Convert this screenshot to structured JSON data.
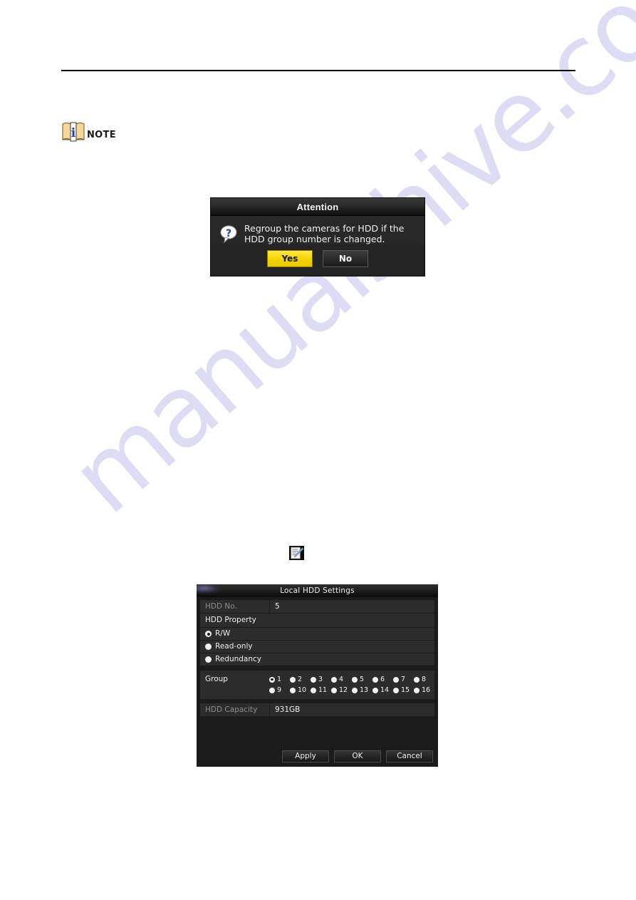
{
  "page": {
    "note_label": "NOTE",
    "note_icon": "note-book-icon",
    "edit_icon": "edit-pencil-icon",
    "watermark_text": "manualshive.com",
    "watermark_color": "#dcdcf5"
  },
  "attention_dialog": {
    "title": "Attention",
    "icon": "question-bubble-icon",
    "message": "Regroup the cameras for HDD if the\nHDD group number is changed.",
    "buttons": {
      "yes": "Yes",
      "no": "No"
    },
    "accent_color": "#f5d400"
  },
  "hdd_dialog": {
    "title": "Local HDD Settings",
    "hdd_no": {
      "label": "HDD No.",
      "value": "5"
    },
    "property_section": {
      "header": "HDD Property",
      "options": [
        {
          "label": "R/W",
          "selected": true
        },
        {
          "label": "Read-only",
          "selected": false
        },
        {
          "label": "Redundancy",
          "selected": false
        }
      ]
    },
    "group": {
      "label": "Group",
      "row1": [
        {
          "label": "1",
          "selected": true
        },
        {
          "label": "2",
          "selected": false
        },
        {
          "label": "3",
          "selected": false
        },
        {
          "label": "4",
          "selected": false
        },
        {
          "label": "5",
          "selected": false
        },
        {
          "label": "6",
          "selected": false
        },
        {
          "label": "7",
          "selected": false
        },
        {
          "label": "8",
          "selected": false
        }
      ],
      "row2": [
        {
          "label": "9",
          "selected": false
        },
        {
          "label": "10",
          "selected": false
        },
        {
          "label": "11",
          "selected": false
        },
        {
          "label": "12",
          "selected": false
        },
        {
          "label": "13",
          "selected": false
        },
        {
          "label": "14",
          "selected": false
        },
        {
          "label": "15",
          "selected": false
        },
        {
          "label": "16",
          "selected": false
        }
      ]
    },
    "capacity": {
      "label": "HDD Capacity",
      "value": "931GB"
    },
    "buttons": {
      "apply": "Apply",
      "ok": "OK",
      "cancel": "Cancel"
    }
  }
}
